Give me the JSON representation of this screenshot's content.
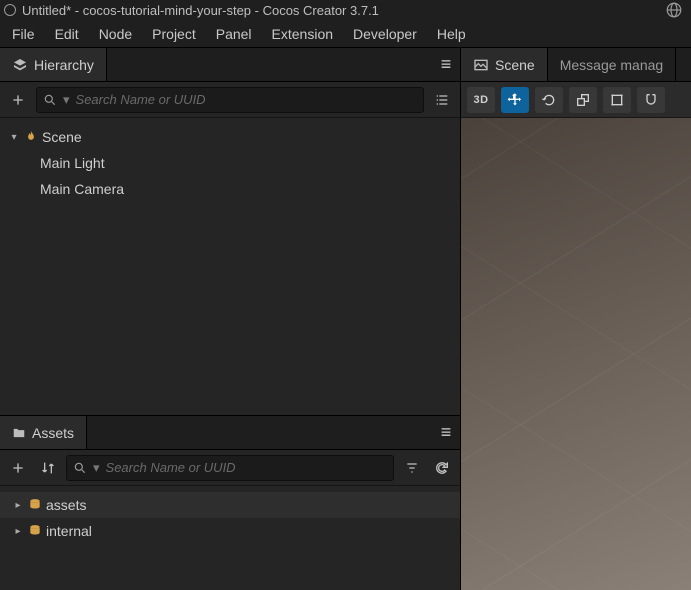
{
  "window": {
    "title": "Untitled* - cocos-tutorial-mind-your-step - Cocos Creator 3.7.1"
  },
  "menu": {
    "file": "File",
    "edit": "Edit",
    "node": "Node",
    "project": "Project",
    "panel": "Panel",
    "extension": "Extension",
    "developer": "Developer",
    "help": "Help"
  },
  "hierarchy": {
    "tab": "Hierarchy",
    "search_placeholder": "Search Name or UUID",
    "nodes": {
      "scene": "Scene",
      "mainLight": "Main Light",
      "mainCamera": "Main Camera"
    }
  },
  "assets": {
    "tab": "Assets",
    "search_placeholder": "Search Name or UUID",
    "items": {
      "assets": "assets",
      "internal": "internal"
    }
  },
  "scenePanel": {
    "tab_scene": "Scene",
    "tab_message": "Message manag",
    "tool_3d": "3D"
  }
}
